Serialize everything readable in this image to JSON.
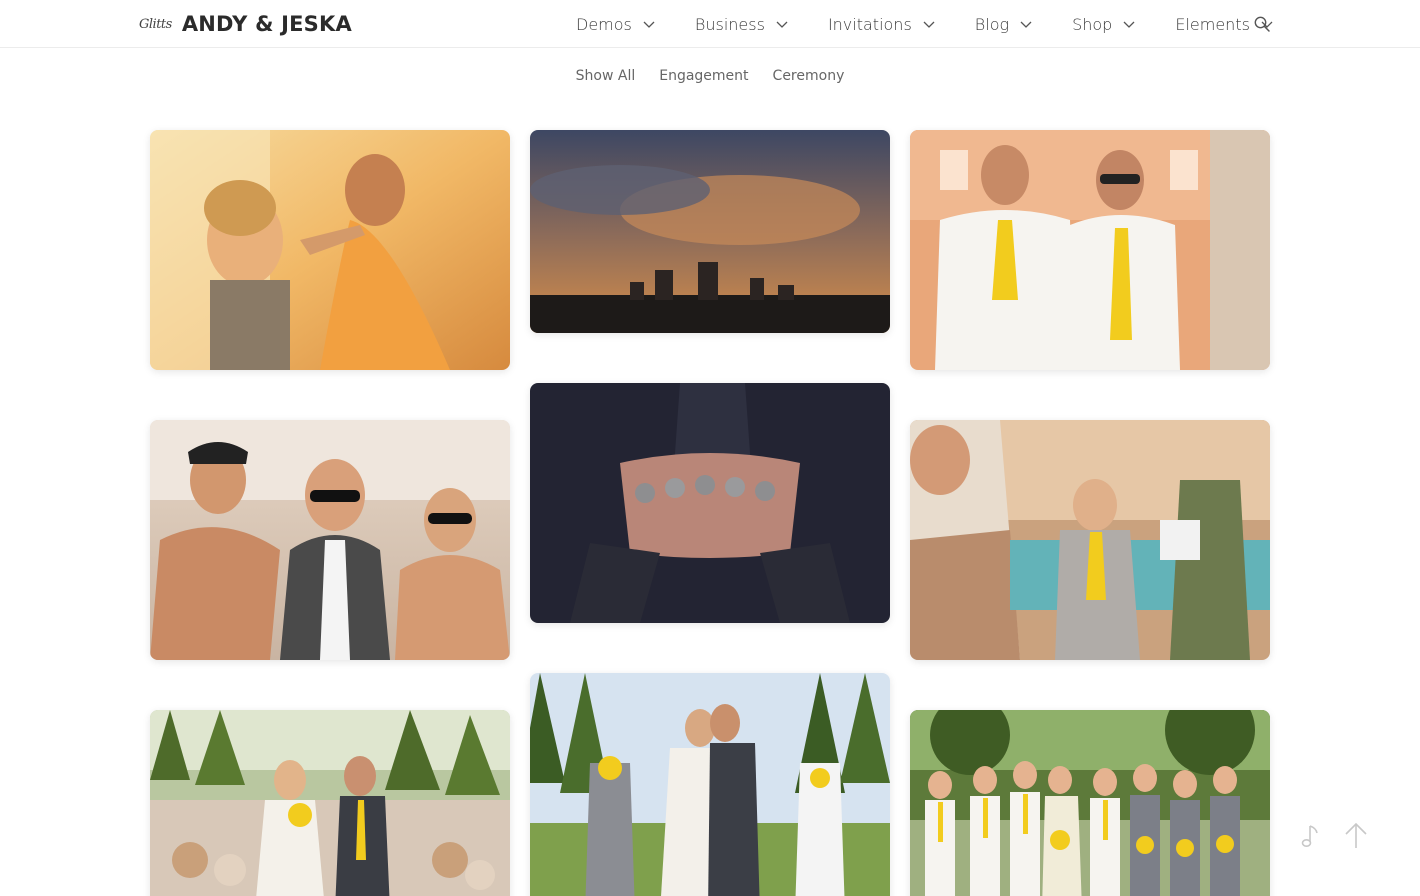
{
  "header": {
    "logo_script": "Glitts",
    "logo_text": "ANDY & JESKA",
    "nav": [
      {
        "label": "Demos"
      },
      {
        "label": "Business"
      },
      {
        "label": "Invitations"
      },
      {
        "label": "Blog"
      },
      {
        "label": "Shop"
      },
      {
        "label": "Elements"
      }
    ]
  },
  "filters": [
    "Show All",
    "Engagement",
    "Ceremony"
  ],
  "icons": {
    "search": "search-icon",
    "chevron": "chevron-down-icon",
    "music": "music-note-icon",
    "back_to_top": "arrow-up-icon"
  },
  "colors": {
    "accent_yellow": "#f2cc1e",
    "text": "#3a3a3a",
    "muted": "#666666"
  }
}
